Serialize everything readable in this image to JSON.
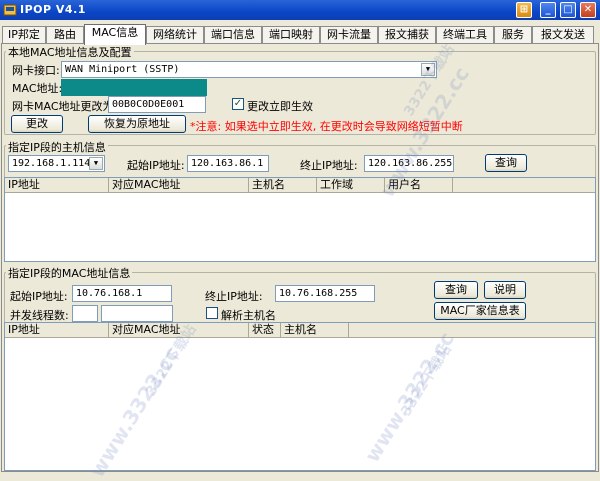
{
  "window": {
    "title": "IPOP V4.1",
    "controls": {
      "extra": "⊞",
      "minimize": "_",
      "maximize": "□",
      "close": "✕"
    }
  },
  "tabs": [
    {
      "label": "IP邦定"
    },
    {
      "label": "路由"
    },
    {
      "label": "MAC信息"
    },
    {
      "label": "网络统计"
    },
    {
      "label": "端口信息"
    },
    {
      "label": "端口映射"
    },
    {
      "label": "网卡流量"
    },
    {
      "label": "报文捕获"
    },
    {
      "label": "终端工具"
    },
    {
      "label": "服务"
    },
    {
      "label": "报文发送"
    }
  ],
  "active_tab": "MAC信息",
  "local_mac": {
    "group_label": "本地MAC地址信息及配置",
    "nic_label": "网卡接口:",
    "nic_value": "WAN Miniport (SSTP)",
    "mac_label": "MAC地址:",
    "mac_value": "",
    "change_to_label": "网卡MAC地址更改为:",
    "change_to_value": "00B0C0D0E001",
    "immediate_label": "更改立即生效",
    "immediate_checked": "✓",
    "change_button": "更改",
    "restore_button": "恢复为原地址",
    "warning": "*注意: 如果选中立即生效, 在更改时会导致网络短暂中断"
  },
  "host_info": {
    "group_label": "指定IP段的主机信息",
    "ip_select_value": "192.168.1.114",
    "start_label": "起始IP地址:",
    "start_value": "120.163.86.1",
    "end_label": "终止IP地址:",
    "end_value": "120.163.86.255",
    "query_button": "查询",
    "columns": [
      "IP地址",
      "对应MAC地址",
      "主机名",
      "工作域",
      "用户名"
    ]
  },
  "mac_range": {
    "group_label": "指定IP段的MAC地址信息",
    "start_label": "起始IP地址:",
    "start_value": "10.76.168.1",
    "end_label": "终止IP地址:",
    "end_value": "10.76.168.255",
    "threads_label": "并发线程数:",
    "threads_value": "",
    "threads_extra_value": "",
    "resolve_label": "解析主机名",
    "query_button": "查询",
    "help_button": "说明",
    "vendor_button": "MAC厂家信息表",
    "columns": [
      "IP地址",
      "对应MAC地址",
      "状态",
      "主机名"
    ]
  },
  "colors": {
    "mac_field": "#0c8a8a",
    "titlebar": "#0a46c8",
    "warning": "#ff0000"
  },
  "watermarks": [
    "3322下载站",
    "www.3322.cc"
  ]
}
